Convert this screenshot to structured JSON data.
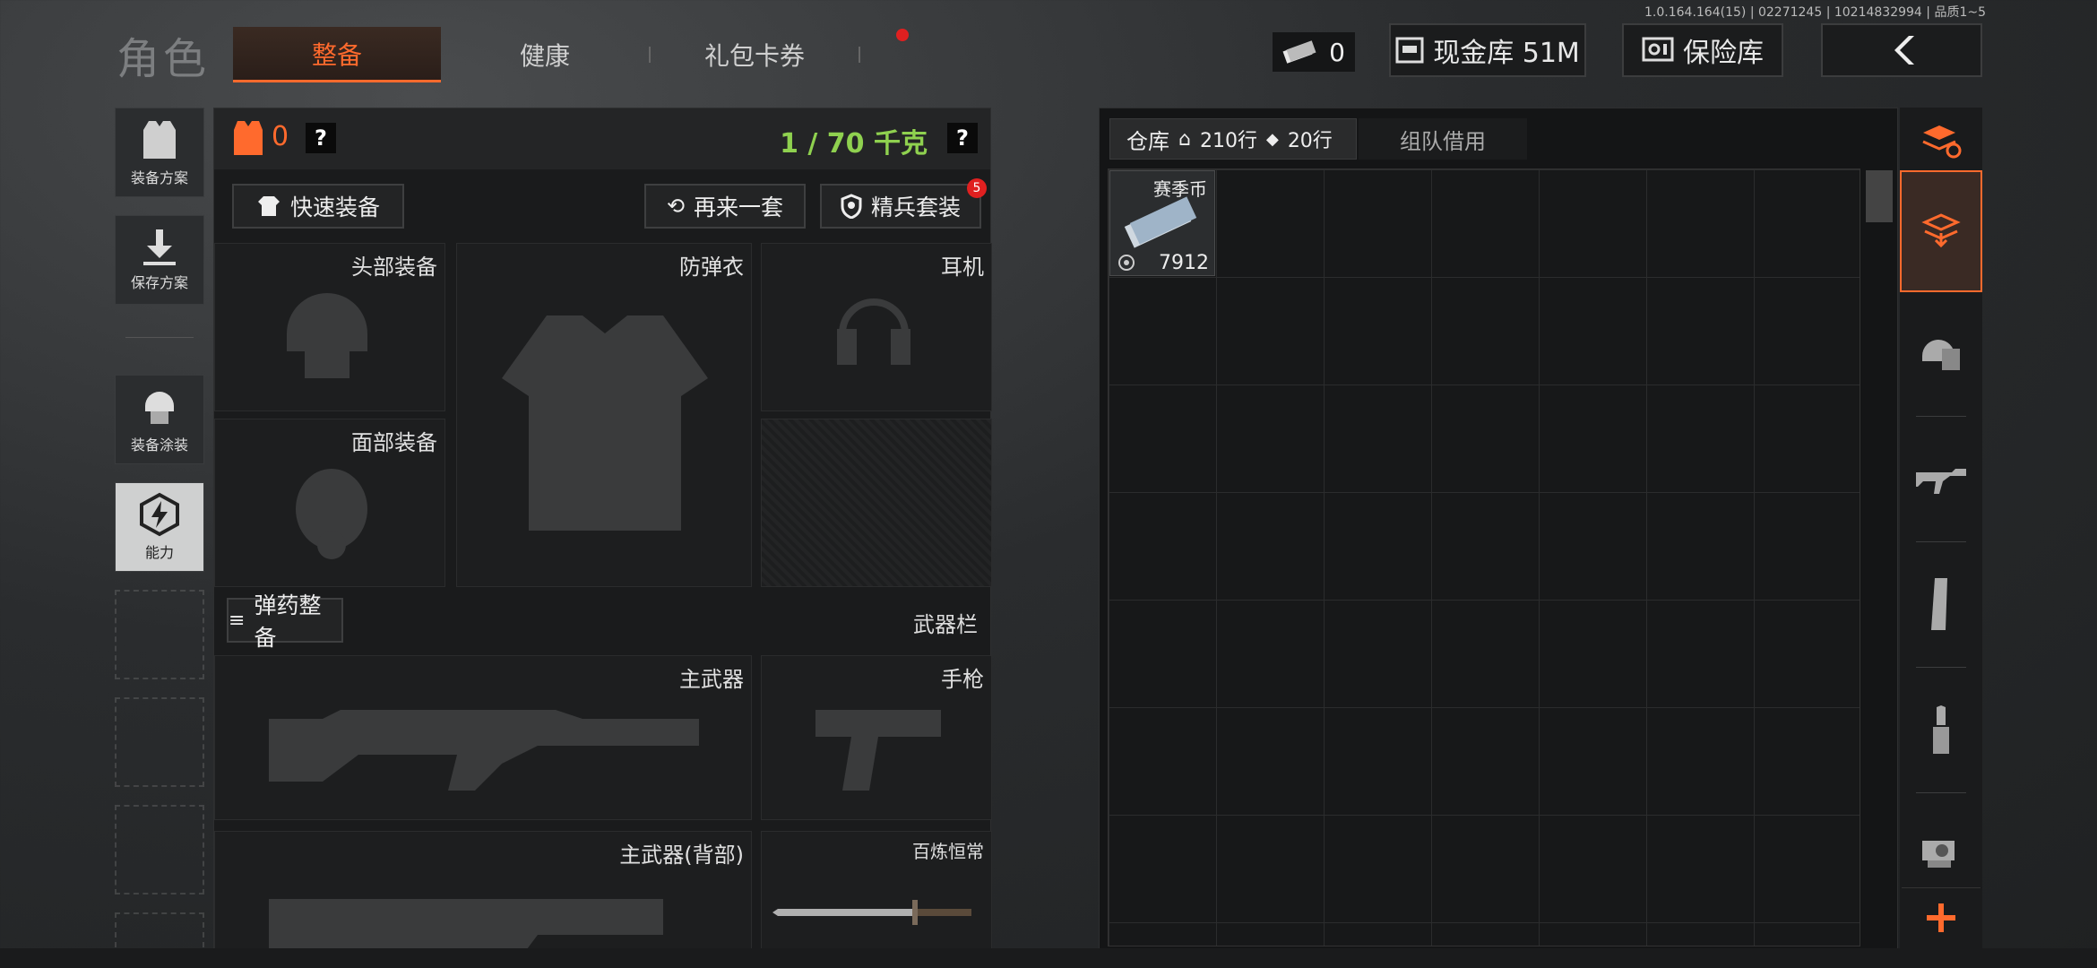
{
  "version": "1.0.164.164(15) | 02271245 | 10214832994 | 品质1~5",
  "header": {
    "title": "角色",
    "tabs": [
      {
        "label": "整备"
      },
      {
        "label": "健康"
      },
      {
        "label": "礼包卡券"
      }
    ],
    "money": "0",
    "cash_vault": "现金库 51M",
    "safe": "保险库"
  },
  "sidebar": {
    "items": [
      {
        "label": "装备方案"
      },
      {
        "label": "保存方案"
      },
      {
        "label": "装备涂装"
      },
      {
        "label": "能力"
      }
    ]
  },
  "loadout": {
    "armor_value": "0",
    "weight": "1 / 70 千克",
    "quick_equip": "快速装备",
    "again": "再来一套",
    "elite_set": "精兵套装",
    "elite_badge": "5",
    "slots": {
      "head": "头部装备",
      "vest": "防弹衣",
      "headset": "耳机",
      "face": "面部装备",
      "primary": "主武器",
      "pistol": "手枪",
      "primary_back": "主武器(背部)",
      "melee": "百炼恒常"
    },
    "ammo_btn": "弹药整备",
    "weapon_bar": "武器栏"
  },
  "warehouse": {
    "label": "仓库",
    "rows": "210行",
    "rows2": "20行",
    "team_borrow": "组队借用",
    "items": [
      {
        "name": "赛季币",
        "count": "7912"
      }
    ]
  },
  "colors": {
    "accent": "#ff6a2d",
    "weight_green": "#8fd14f",
    "badge_red": "#e02020"
  }
}
